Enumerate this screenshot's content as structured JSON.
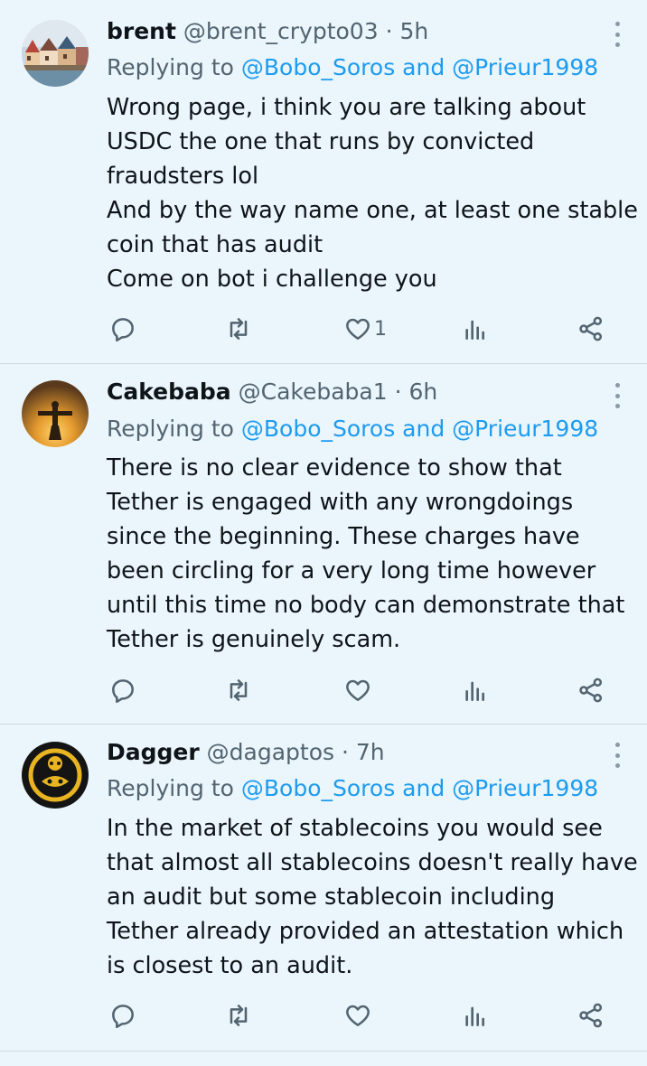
{
  "tweets": [
    {
      "name": "brent",
      "handle": "@brent_crypto03",
      "separator": "·",
      "time": "5h",
      "replying_prefix": "Replying to",
      "replying_users": "@Bobo_Soros and @Prieur1998",
      "body_lines": [
        "Wrong page, i think you are talking about",
        "USDC the one that runs by convicted",
        "fraudsters lol",
        "And by the way name one, at least one stable",
        "coin that has audit",
        "Come on bot i challenge you"
      ],
      "like_count": "1"
    },
    {
      "name": "Cakebaba",
      "handle": "@Cakebaba1",
      "separator": "·",
      "time": "6h",
      "replying_prefix": "Replying to",
      "replying_users": "@Bobo_Soros and @Prieur1998",
      "body_lines": [
        "There is no clear evidence to show that",
        "Tether is engaged with any wrongdoings",
        "since the beginning. These charges have",
        "been circling for a very long time however",
        "until this time no body can demonstrate that",
        "Tether is genuinely scam."
      ],
      "like_count": ""
    },
    {
      "name": "Dagger",
      "handle": "@dagaptos",
      "separator": "·",
      "time": "7h",
      "replying_prefix": "Replying to",
      "replying_users": "@Bobo_Soros and @Prieur1998",
      "body_lines": [
        "In the market of stablecoins you would see",
        "that almost all stablecoins doesn't really have",
        "an audit but some stablecoin including",
        "Tether already provided an attestation which",
        "is closest to an audit."
      ],
      "like_count": ""
    }
  ],
  "icons": {
    "reply": "reply-icon",
    "retweet": "retweet-icon",
    "like": "heart-icon",
    "views": "views-icon",
    "share": "share-icon",
    "more": "more-options-icon"
  },
  "colors": {
    "background": "#eaf6fb",
    "link": "#1d9bf0",
    "secondary_text": "#536471",
    "primary_text": "#0f1419",
    "divider": "#cfd9de"
  }
}
